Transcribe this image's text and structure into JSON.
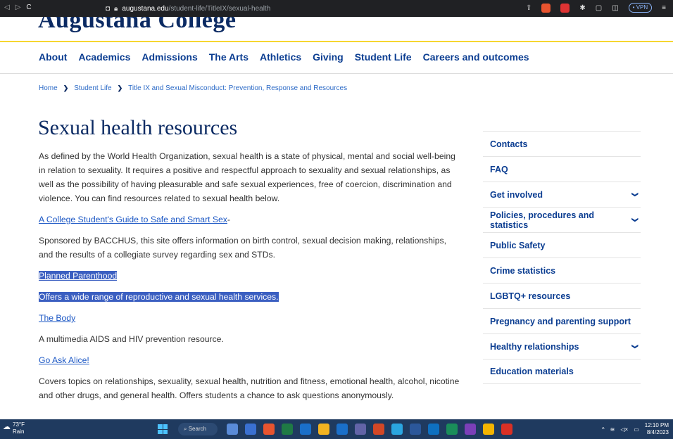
{
  "browser": {
    "url_host": "augustana.edu",
    "url_path": "/student-life/TitleIX/sexual-health",
    "vpn_label": "• VPN"
  },
  "site": {
    "logo_text": "Augustana College",
    "nav": [
      "About",
      "Academics",
      "Admissions",
      "The Arts",
      "Athletics",
      "Giving",
      "Student Life",
      "Careers and outcomes"
    ]
  },
  "breadcrumb": [
    "Home",
    "Student Life",
    "Title IX and Sexual Misconduct: Prevention, Response and Resources"
  ],
  "page": {
    "title": "Sexual health resources",
    "intro": "As defined by the World Health Organization, sexual health is a state of physical, mental and social well-being in relation to sexuality. It requires a positive and respectful approach to sexuality and sexual relationships, as well as the possibility of having pleasurable and safe sexual experiences, free of coercion, discrimination and violence. You can find resources related to sexual health below.",
    "link1": "A College Student's Guide to Safe and Smart Sex",
    "link1_suffix": "-",
    "desc1": "Sponsored by BACCHUS, this site offers information on birth control, sexual decision making, relationships, and the results of a collegiate survey regarding sex and STDs.",
    "link2": "Planned Parenthood",
    "desc2": "Offers a wide range of reproductive and sexual health services.",
    "link3": "The Body",
    "desc3": "A multimedia AIDS and HIV prevention resource.",
    "link4": "Go Ask Alice!",
    "desc4": "Covers topics on relationships, sexuality, sexual health, nutrition and fitness, emotional health, alcohol, nicotine and other drugs, and general health. Offers students a chance to ask questions anonymously."
  },
  "sidebar": [
    {
      "label": "Contacts",
      "chevron": false
    },
    {
      "label": "FAQ",
      "chevron": false
    },
    {
      "label": "Get involved",
      "chevron": true
    },
    {
      "label": "Policies, procedures and statistics",
      "chevron": true
    },
    {
      "label": "Public Safety",
      "chevron": false
    },
    {
      "label": "Crime statistics",
      "chevron": false
    },
    {
      "label": "LGBTQ+ resources",
      "chevron": false
    },
    {
      "label": "Pregnancy and parenting support",
      "chevron": false
    },
    {
      "label": "Healthy relationships",
      "chevron": true
    },
    {
      "label": "Education materials",
      "chevron": false
    }
  ],
  "taskbar": {
    "temp": "73°F",
    "weather": "Rain",
    "search": "Search",
    "time": "12:10 PM",
    "date": "8/4/2023"
  },
  "colors": {
    "brand_navy": "#0b2a63",
    "accent_gold": "#f6d630",
    "link_blue": "#1a56c4",
    "selection": "#3b5fc1"
  }
}
